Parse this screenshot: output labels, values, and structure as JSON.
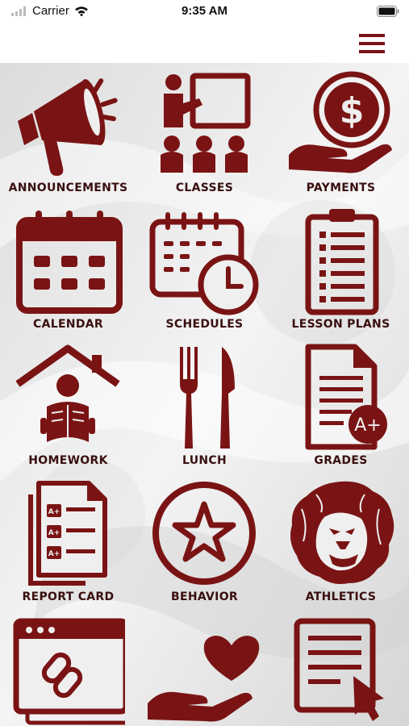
{
  "status_bar": {
    "carrier": "Carrier",
    "time": "9:35 AM"
  },
  "colors": {
    "brand": "#7a1414",
    "label_text": "#3a0f0f",
    "background": "#e9e9e9"
  },
  "tiles": [
    {
      "label": "ANNOUNCEMENTS",
      "icon": "megaphone-icon"
    },
    {
      "label": "CLASSES",
      "icon": "classroom-icon"
    },
    {
      "label": "PAYMENTS",
      "icon": "dollar-coin-hand-icon"
    },
    {
      "label": "CALENDAR",
      "icon": "calendar-icon"
    },
    {
      "label": "SCHEDULES",
      "icon": "calendar-clock-icon"
    },
    {
      "label": "LESSON PLANS",
      "icon": "clipboard-icon"
    },
    {
      "label": "HOMEWORK",
      "icon": "house-reader-icon"
    },
    {
      "label": "LUNCH",
      "icon": "fork-knife-icon"
    },
    {
      "label": "GRADES",
      "icon": "document-grade-icon"
    },
    {
      "label": "REPORT CARD",
      "icon": "report-card-icon"
    },
    {
      "label": "BEHAVIOR",
      "icon": "star-circle-icon"
    },
    {
      "label": "ATHLETICS",
      "icon": "lion-head-icon"
    },
    {
      "label": "",
      "icon": "browser-link-icon"
    },
    {
      "label": "",
      "icon": "heart-hand-icon"
    },
    {
      "label": "",
      "icon": "document-cursor-icon"
    }
  ],
  "tile_badges": {
    "grades_badge": "A+",
    "report_card_badges": [
      "A+",
      "A+",
      "A+"
    ]
  }
}
